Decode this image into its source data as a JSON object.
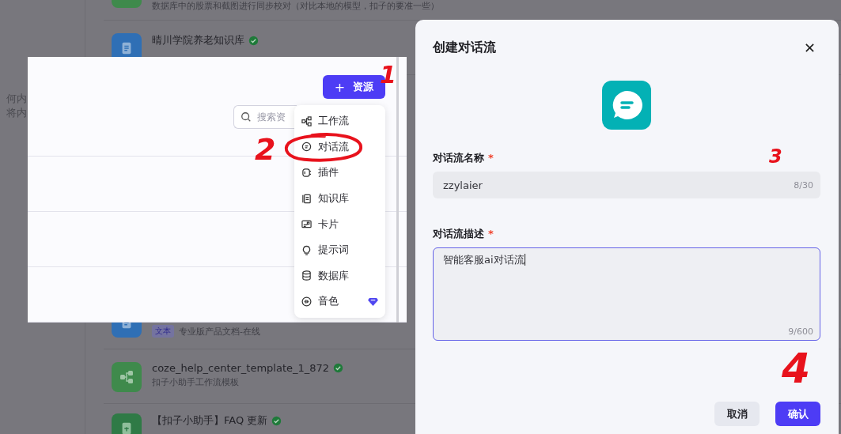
{
  "empty_hint": {
    "lines": [
      "何内",
      "将内"
    ]
  },
  "resources": [
    {
      "kind": "database",
      "description": "数据库中的股票和截图进行同步校对（对比本地的模型，扣子的要准一些）"
    },
    {
      "kind": "knowledge",
      "title": "晴川学院养老知识库",
      "verified": true
    },
    {
      "kind": "knowledge",
      "tag": "文本",
      "description": "专业版产品文档-在线"
    },
    {
      "kind": "workflow",
      "title": "coze_help_center_template_1_872",
      "verified": true,
      "description": "扣子小助手工作流模板"
    },
    {
      "kind": "table",
      "title": "【扣子小助手】FAQ 更新",
      "verified": true
    }
  ],
  "panel": {
    "add_button": {
      "icon": "+",
      "label": "资源"
    },
    "search": {
      "placeholder": "搜索资"
    },
    "menu": [
      {
        "kind": "workflow",
        "label": "工作流",
        "premium": false
      },
      {
        "kind": "chatflow",
        "label": "对话流",
        "premium": false
      },
      {
        "kind": "plugin",
        "label": "插件",
        "premium": false
      },
      {
        "kind": "knowledge",
        "label": "知识库",
        "premium": false
      },
      {
        "kind": "card",
        "label": "卡片",
        "premium": false
      },
      {
        "kind": "prompt",
        "label": "提示词",
        "premium": false
      },
      {
        "kind": "database",
        "label": "数据库",
        "premium": false
      },
      {
        "kind": "voice",
        "label": "音色",
        "premium": true
      }
    ]
  },
  "dialog": {
    "title": "创建对话流",
    "name_field": {
      "label": "对话流名称",
      "required_mark": "*",
      "value": "zzylaier",
      "count": "8/30"
    },
    "description_field": {
      "label": "对话流描述",
      "required_mark": "*",
      "value": "智能客服ai对话流",
      "count": "9/600",
      "focused": true
    },
    "buttons": [
      {
        "kind": "secondary",
        "label": "取消"
      },
      {
        "kind": "primary",
        "label": "确认"
      }
    ]
  },
  "annotations": [
    "1",
    "2",
    "3",
    "4"
  ]
}
